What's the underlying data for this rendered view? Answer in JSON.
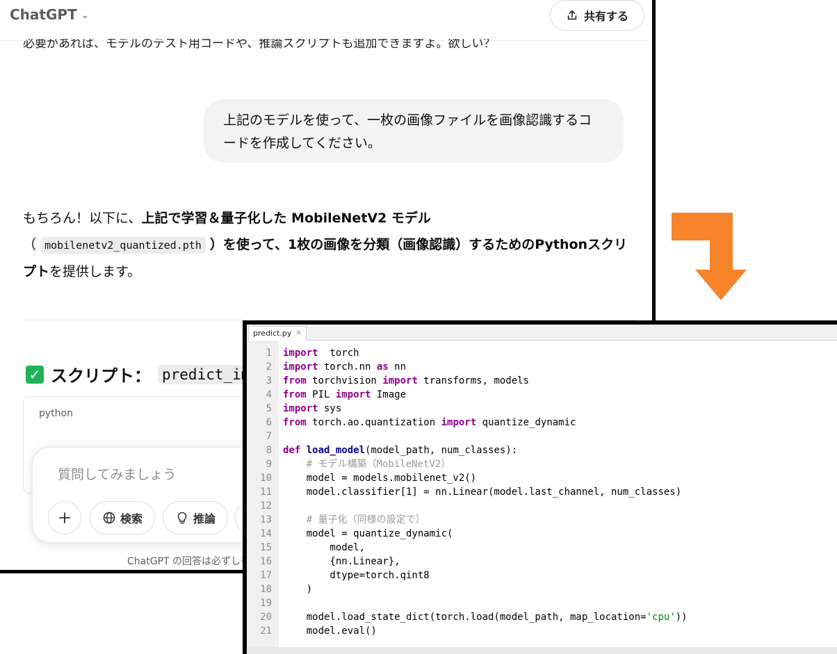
{
  "app": {
    "title": "ChatGPT",
    "share_label": "共有する"
  },
  "chat": {
    "cut_line": "必要があれば、モデルのテスト用コードや、推論スクリプトも追加できますよ。欲しい？",
    "user_message": "上記のモデルを使って、一枚の画像ファイルを画像認識するコードを作成してください。",
    "answer_1": "もちろん！以下に、",
    "answer_2": "上記で学習＆量子化した MobileNetV2 モデル",
    "answer_3": "（",
    "answer_code": "mobilenetv2_quantized.pth",
    "answer_4": "）を使って、1枚の画像を分類（画像認識）するためのPythonスクリプト",
    "answer_5": "を提供します。",
    "script_heading": "スクリプト：",
    "script_heading_code": "predict_image.py",
    "code_lang": "python"
  },
  "composer": {
    "placeholder": "質問してみましょう",
    "search_label": "検索",
    "think_label": "推論",
    "disclaimer": "ChatGPT の回答は必ずしも正しいとは限りません。"
  },
  "colors": {
    "accent_arrow": "#f7832a",
    "check_green": "#22b35a"
  },
  "editor": {
    "tab_name": "predict.py",
    "lines": [
      [
        [
          "kw",
          "import"
        ],
        [
          "",
          "  torch"
        ]
      ],
      [
        [
          "kw",
          "import"
        ],
        [
          "",
          " torch.nn "
        ],
        [
          "kw",
          "as"
        ],
        [
          "",
          " nn"
        ]
      ],
      [
        [
          "kw",
          "from"
        ],
        [
          "",
          " torchvision "
        ],
        [
          "kw",
          "import"
        ],
        [
          "",
          " transforms, models"
        ]
      ],
      [
        [
          "kw",
          "from"
        ],
        [
          "",
          " PIL "
        ],
        [
          "kw",
          "import"
        ],
        [
          "",
          " Image"
        ]
      ],
      [
        [
          "kw",
          "import"
        ],
        [
          "",
          " sys"
        ]
      ],
      [
        [
          "kw",
          "from"
        ],
        [
          "",
          " torch.ao.quantization "
        ],
        [
          "kw",
          "import"
        ],
        [
          "",
          " quantize_dynamic"
        ]
      ],
      [],
      [
        [
          "kw",
          "def"
        ],
        [
          "",
          " "
        ],
        [
          "fn",
          "load_model"
        ],
        [
          "",
          "(model_path, num_classes):"
        ]
      ],
      [
        [
          "",
          "    "
        ],
        [
          "cm",
          "# モデル構築（MobileNetV2）"
        ]
      ],
      [
        [
          "",
          "    model = models.mobilenet_v2()"
        ]
      ],
      [
        [
          "",
          "    model.classifier[1] = nn.Linear(model.last_channel, num_classes)"
        ]
      ],
      [],
      [
        [
          "",
          "    "
        ],
        [
          "cm",
          "# 量子化（同様の設定で）"
        ]
      ],
      [
        [
          "",
          "    model = quantize_dynamic("
        ]
      ],
      [
        [
          "",
          "        model,"
        ]
      ],
      [
        [
          "",
          "        {nn.Linear},"
        ]
      ],
      [
        [
          "",
          "        dtype=torch.qint8"
        ]
      ],
      [
        [
          "",
          "    )"
        ]
      ],
      [],
      [
        [
          "",
          "    model.load_state_dict(torch.load(model_path, map_location="
        ],
        [
          "st",
          "'cpu'"
        ],
        [
          "",
          "))"
        ]
      ],
      [
        [
          "",
          "    model.eval()"
        ]
      ]
    ]
  }
}
